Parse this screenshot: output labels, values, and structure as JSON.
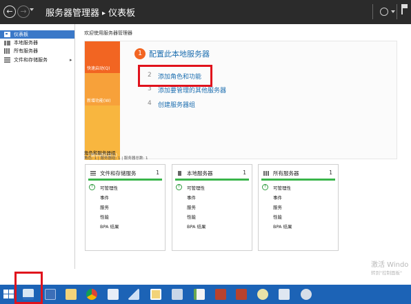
{
  "title_bar": {
    "app_name": "服务器管理器",
    "separator": "▸",
    "current_page": "仪表板"
  },
  "sidebar": {
    "items": [
      {
        "label": "仪表板",
        "icon": "dashboard-icon",
        "active": true
      },
      {
        "label": "本地服务器",
        "icon": "local-server-icon",
        "active": false
      },
      {
        "label": "所有服务器",
        "icon": "all-servers-icon",
        "active": false
      },
      {
        "label": "文件和存储服务",
        "icon": "file-storage-icon",
        "active": false,
        "has_children": true
      }
    ]
  },
  "main": {
    "welcome": "欢迎使用服务器管理器",
    "quick_start": {
      "tiles": [
        "快速启动(Q)",
        "新增功能(W)",
        "了解详细信息(L)"
      ],
      "step1_number": "1",
      "step1_label": "配置此本地服务器",
      "steps": [
        {
          "number": "2",
          "label": "添加角色和功能"
        },
        {
          "number": "3",
          "label": "添加要管理的其他服务器"
        },
        {
          "number": "4",
          "label": "创建服务器组"
        }
      ]
    },
    "roles": {
      "title": "角色和服务器组",
      "subtitle": "角色: 1 | 服务器组: 1 | 服务器总数: 1",
      "cards": [
        {
          "title": "文件和存储服务",
          "count": "1",
          "rows": [
            "可管理性",
            "事件",
            "服务",
            "性能",
            "BPA 结果"
          ]
        },
        {
          "title": "本地服务器",
          "count": "1",
          "rows": [
            "可管理性",
            "事件",
            "服务",
            "性能",
            "BPA 结果"
          ]
        },
        {
          "title": "所有服务器",
          "count": "1",
          "rows": [
            "可管理性",
            "事件",
            "服务",
            "性能",
            "BPA 结果"
          ]
        }
      ]
    },
    "watermark": {
      "line1": "激活 Windo",
      "line2": "转到\"控制面板\""
    }
  },
  "taskbar": {
    "apps": [
      "server-manager-icon",
      "powershell-icon",
      "file-explorer-icon",
      "chrome-icon",
      "remote-desktop-icon",
      "ship-icon",
      "search-tool-icon",
      "network-tool-icon",
      "notepad-icon",
      "package-icon",
      "package-icon",
      "globe-tool-icon",
      "monitor-tool-icon",
      "settings-icon"
    ]
  },
  "colors": {
    "accent_blue": "#1e6fb0",
    "orange": "#f26522",
    "highlight_red": "#e0121c",
    "taskbar": "#1c63b6",
    "status_green": "#39b54a"
  }
}
